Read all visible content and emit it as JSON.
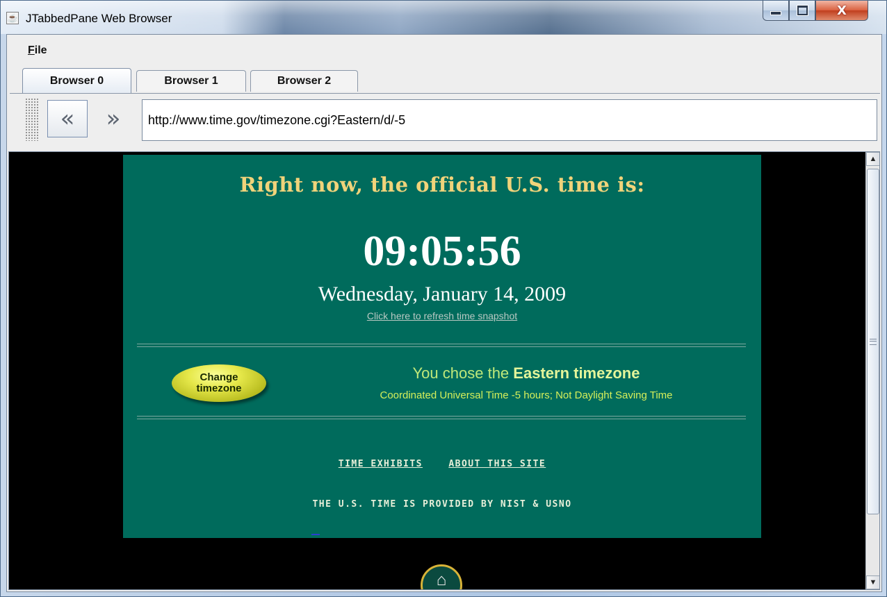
{
  "window": {
    "title": "JTabbedPane Web Browser",
    "icons": {
      "app": "java-cup-icon",
      "minimize": "minimize-icon",
      "maximize": "maximize-icon",
      "close": "close-icon"
    },
    "close_glyph": "X"
  },
  "menu": {
    "file_mnemonic": "F",
    "file_rest": "ile"
  },
  "tabs": [
    {
      "label": "Browser 0",
      "selected": true
    },
    {
      "label": "Browser 1",
      "selected": false
    },
    {
      "label": "Browser 2",
      "selected": false
    }
  ],
  "toolbar": {
    "back_icon": "back-chevron-icon",
    "forward_icon": "forward-chevron-icon",
    "url": "http://www.time.gov/timezone.cgi?Eastern/d/-5"
  },
  "webpage": {
    "headline": "Right now, the official U.S. time is:",
    "time": "09:05:56",
    "date": "Wednesday, January 14, 2009",
    "refresh_link": "Click here to refresh time snapshot",
    "change_button_line1": "Change",
    "change_button_line2": "timezone",
    "chosen_prefix": "You chose the",
    "chosen_zone": "Eastern timezone",
    "tz_detail": "Coordinated Universal Time -5 hours; Not Daylight Saving Time",
    "link_exhibits": "TIME EXHIBITS",
    "link_about": "ABOUT THIS SITE",
    "provided_by": "THE U.S. TIME IS PROVIDED BY NIST & USNO",
    "home_icon": "home-icon",
    "colors": {
      "page_bg": "#006b5c",
      "headline": "#f0d37a",
      "button": "#e6e84a",
      "outer_bg": "#000000"
    }
  }
}
